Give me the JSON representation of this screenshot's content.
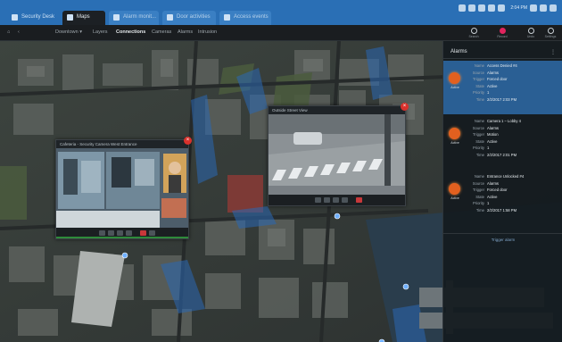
{
  "tabs": [
    {
      "label": "Security Desk",
      "state": "normal"
    },
    {
      "label": "Maps",
      "state": "active"
    },
    {
      "label": "Alarm monit...",
      "state": "dim"
    },
    {
      "label": "Door activities",
      "state": "dim"
    },
    {
      "label": "Access events",
      "state": "dim"
    }
  ],
  "titlebar": {
    "clock": "2:04 PM"
  },
  "toolbar": {
    "items": [
      "Downtown ▾",
      "Layers",
      "Connections",
      "Cameras",
      "Alarms",
      "Intrusion"
    ],
    "selected_index": 2,
    "buttons": [
      {
        "icon": "search-icon",
        "label": "Search"
      },
      {
        "icon": "record-icon",
        "label": "Record"
      },
      {
        "icon": "undo-icon",
        "label": "Undo"
      },
      {
        "icon": "settings-icon",
        "label": "Settings"
      }
    ]
  },
  "video_windows": [
    {
      "title": "Cafeteria - Security Camera West Entrance"
    },
    {
      "title": "Outside Street View"
    }
  ],
  "alarms_panel": {
    "title": "Alarms",
    "menu_icon": "⋮",
    "field_keys": [
      "Name",
      "Source",
      "Trigger",
      "State",
      "Priority",
      "Time"
    ],
    "alarms": [
      {
        "badge": "Active",
        "values": [
          "Access Denied #4",
          "Alarms",
          "Forced door",
          "Active",
          "1",
          "2/2/2017 2:03 PM"
        ]
      },
      {
        "badge": "Active",
        "values": [
          "Camera 1 – Lobby 4",
          "Alarms",
          "Motion",
          "Active",
          "1",
          "2/2/2017 2:01 PM"
        ]
      },
      {
        "badge": "Active",
        "values": [
          "Entrance Unlocked #4",
          "Alarms",
          "Forced door",
          "Active",
          "1",
          "2/2/2017 1:58 PM"
        ]
      }
    ],
    "trigger_link": "Trigger alarm"
  },
  "colors": {
    "accent": "#2a6fb5",
    "alarm": "#e2601f",
    "close": "#d8312c",
    "selected_row": "#2a5f94"
  }
}
